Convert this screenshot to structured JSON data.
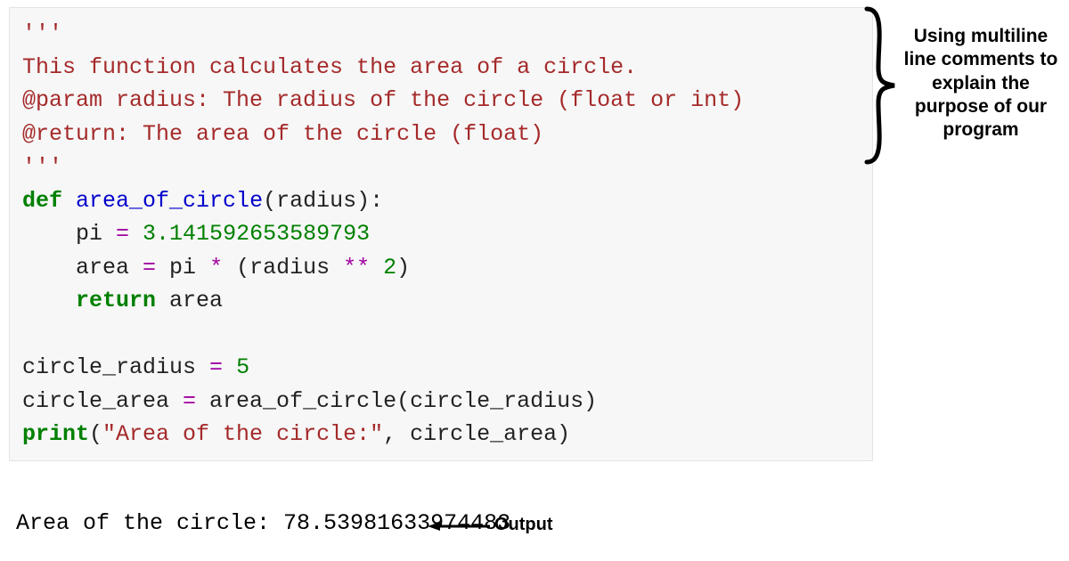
{
  "code": {
    "doc_open": "'''",
    "doc1": "This function calculates the area of a circle.",
    "doc2": "@param radius: The radius of the circle (float or int)",
    "doc3": "@return: The area of the circle (float)",
    "doc_close": "'''",
    "l_def": "def",
    "l_funcname": "area_of_circle",
    "l_sig_rest": "(radius):",
    "pi_assign_pre": "    pi ",
    "pi_eq": "=",
    "pi_val": " 3.141592653589793",
    "area_pre": "    area ",
    "area_eq": "=",
    "area_mid1": " pi ",
    "area_star": "*",
    "area_mid2": " (radius ",
    "area_pow": "**",
    "area_mid3": " ",
    "area_two": "2",
    "area_end": ")",
    "ret_indent": "    ",
    "ret_kw": "return",
    "ret_rest": " area",
    "blank": "",
    "cr_line": "circle_radius ",
    "cr_eq": "=",
    "cr_val": " 5",
    "ca_pre": "circle_area ",
    "ca_eq": "=",
    "ca_rest": " area_of_circle(circle_radius)",
    "print_kw": "print",
    "print_open": "(",
    "print_str": "\"Area of the circle:\"",
    "print_rest": ", circle_area)"
  },
  "output_text": "Area of the circle: 78.53981633974483",
  "annotation_right": "Using multiline line comments to explain the purpose of our program",
  "output_label": "Output",
  "colors": {
    "docstring": "#a52a2a",
    "keyword": "#008000",
    "funcname": "#0000cc",
    "number": "#008000",
    "operator": "#a000a0",
    "code_bg": "#f7f7f7"
  }
}
